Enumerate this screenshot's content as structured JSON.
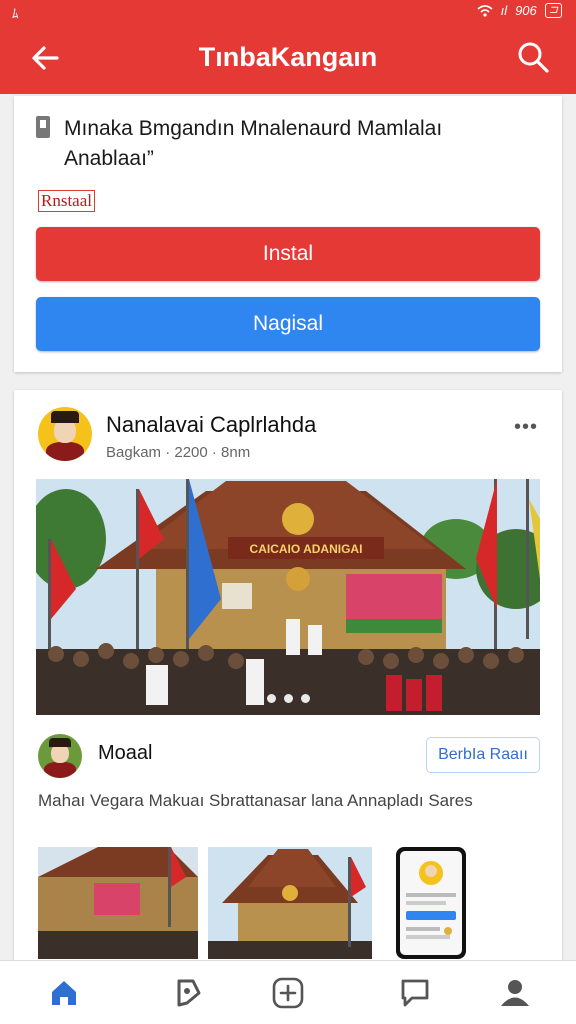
{
  "status_bar": {
    "left": "ﾑ",
    "signal": "ıl",
    "time": "906",
    "battery": "⊐"
  },
  "app_bar": {
    "title": "TınbaKangaın"
  },
  "install_card": {
    "description": "Mınaka Bmgandın Mnalenaurd Mamlalaı Anablaaı”",
    "tag": "Rnstaal",
    "primary_button": "Instal",
    "secondary_button": "Nagisal"
  },
  "post": {
    "author": "Nanalavai Caplrlahda",
    "meta": "Bagkam · 2200 · 8nm",
    "more": "•••",
    "image_banner": "CAICAIO ADANIGAI",
    "commenter": "Moaal",
    "follow_button": "BerbIa Raaıı",
    "caption": "Mahaı Vegara  Makuaı Sbrattanasar lana Annapladı Sares"
  },
  "colors": {
    "brand_red": "#e53935",
    "accent_blue": "#2f86f0",
    "nav_active": "#2f6fd0"
  },
  "bottom_nav": {
    "items": [
      "home-icon",
      "tag-icon",
      "add-icon",
      "chat-icon",
      "profile-icon"
    ],
    "active": "home-icon"
  }
}
